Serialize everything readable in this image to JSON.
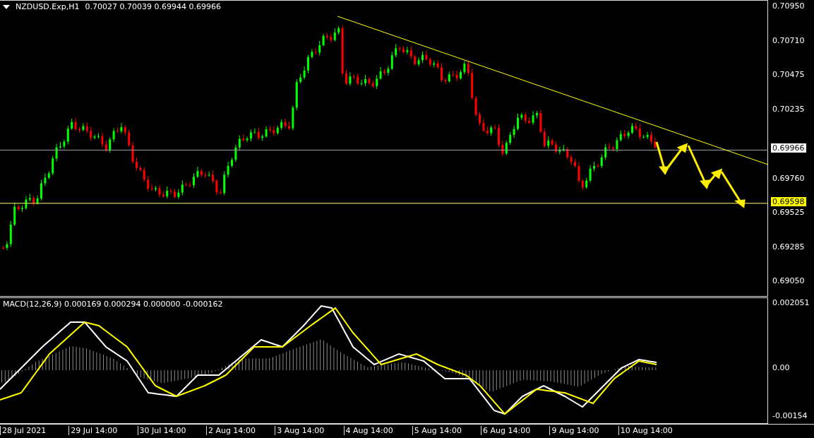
{
  "header": {
    "symbol": "NZDUSD.Exp,H1",
    "ohlc": "0.70027 0.70039 0.69944 0.69966"
  },
  "price_axis": {
    "labels": [
      "0.70950",
      "0.70710",
      "0.70475",
      "0.70235",
      "0.69760",
      "0.69525",
      "0.69285",
      "0.69050"
    ],
    "current_price_tag": "0.69966",
    "line_tag": "0.69598"
  },
  "macd": {
    "title": "MACD(12,26,9) 0.000169 0.000294 0.000000 -0.000162",
    "axis_labels": [
      "0.002051",
      "0.00",
      "-0.00154"
    ]
  },
  "time_axis": {
    "labels": [
      "28 Jul 2021",
      "29 Jul 14:00",
      "30 Jul 14:00",
      "2 Aug 14:00",
      "3 Aug 14:00",
      "4 Aug 14:00",
      "5 Aug 14:00",
      "6 Aug 14:00",
      "9 Aug 14:00",
      "10 Aug 14:00"
    ]
  }
}
